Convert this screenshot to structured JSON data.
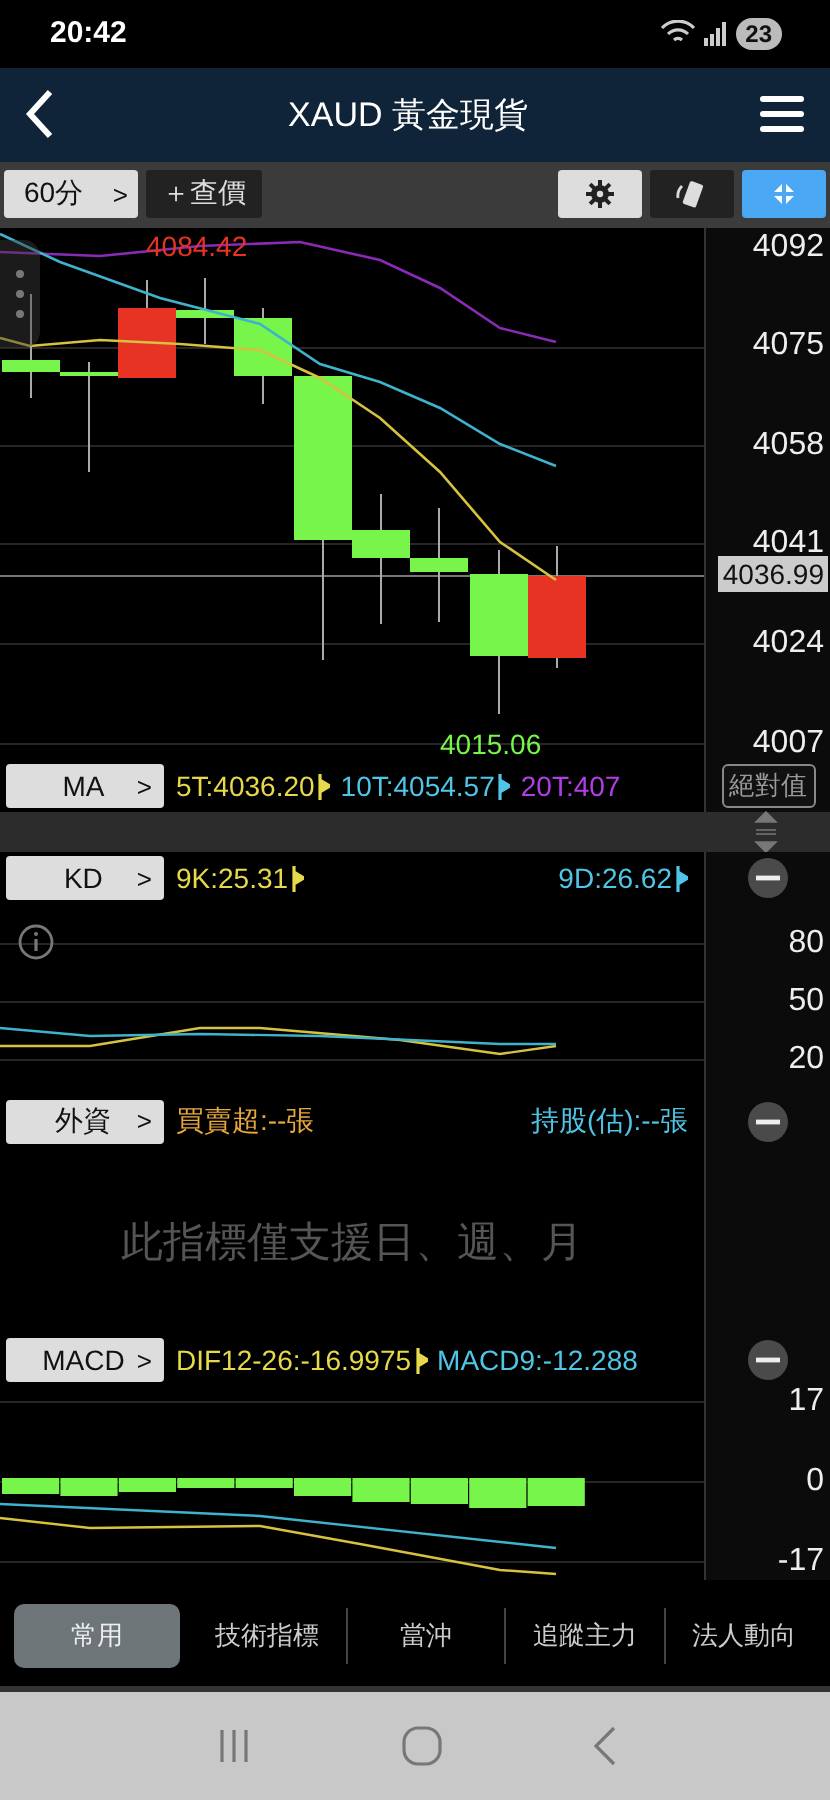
{
  "status_bar": {
    "time": "20:42",
    "battery": "23"
  },
  "header": {
    "title": "XAUD 黃金現貨"
  },
  "toolbar": {
    "period": "60分",
    "period_arrow": ">",
    "quote_button": "＋查價",
    "buttons": [
      {
        "kind": "settings",
        "selected": false
      },
      {
        "kind": "rotate",
        "selected": false
      },
      {
        "kind": "fullscreen",
        "selected": true
      }
    ]
  },
  "main_chart": {
    "y_ticks": [
      "4092",
      "4075",
      "4058",
      "4041",
      "4024",
      "4007"
    ],
    "current_price": "4036.99",
    "high_label": "4084.42",
    "low_label": "4015.06"
  },
  "indicators": [
    {
      "kind": "ma",
      "name": "MA",
      "arrow": ">",
      "side_button": "絕對值",
      "values": [
        {
          "text": "5T:4036.20",
          "color": "#e6d94a",
          "flag": true
        },
        {
          "text": "10T:4054.57",
          "color": "#4fc6e8",
          "flag": true
        },
        {
          "text": "20T:407",
          "color": "#b23ee6",
          "flag": false
        }
      ]
    },
    {
      "kind": "kd",
      "name": "KD",
      "arrow": ">",
      "removable": true,
      "values": [
        {
          "text": "9K:25.31",
          "color": "#e6d94a",
          "flag": true
        },
        {
          "text": "9D:26.62",
          "color": "#4fc6e8",
          "flag": true
        }
      ]
    },
    {
      "kind": "foreign",
      "name": "外資",
      "arrow": ">",
      "removable": true,
      "message": "此指標僅支援日、週、月",
      "values": [
        {
          "text": "買賣超:--張",
          "color": "#e8a83a",
          "flag": false
        },
        {
          "text": "持股(估):--張",
          "color": "#4fc6e8",
          "flag": false
        }
      ]
    },
    {
      "kind": "macd",
      "name": "MACD",
      "arrow": ">",
      "removable": true,
      "values": [
        {
          "text": "DIF12-26:-16.9975",
          "color": "#e6d94a",
          "flag": true
        },
        {
          "text": "MACD9:-12.288",
          "color": "#4fc6e8",
          "flag": false
        }
      ]
    }
  ],
  "kd_chart": {
    "y_ticks": [
      "80",
      "50",
      "20"
    ]
  },
  "macd_chart": {
    "y_ticks": [
      "17",
      "0",
      "-17"
    ]
  },
  "tabs": [
    {
      "label": "常用",
      "selected": true
    },
    {
      "label": "技術指標",
      "selected": false
    },
    {
      "label": "當沖",
      "selected": false
    },
    {
      "label": "追蹤主力",
      "selected": false
    },
    {
      "label": "法人動向",
      "selected": false
    }
  ]
}
